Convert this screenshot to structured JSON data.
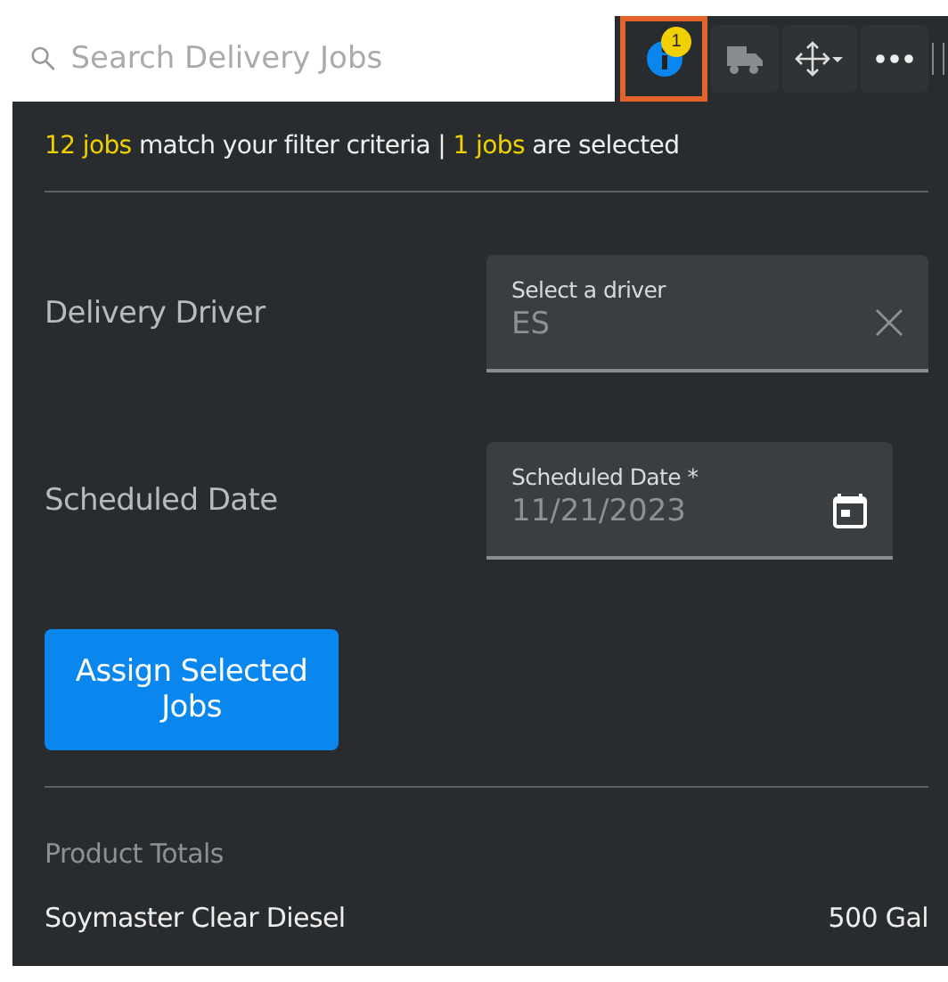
{
  "search": {
    "placeholder": "Search Delivery Jobs"
  },
  "toolbar": [
    {
      "kind": "info",
      "badge": "1",
      "selected": true
    },
    {
      "kind": "truck",
      "selected": false
    },
    {
      "kind": "move",
      "selected": false
    },
    {
      "kind": "more",
      "selected": false
    }
  ],
  "summary": {
    "match_count": "12 jobs",
    "match_text": "match your filter criteria |",
    "selected_count": "1 jobs",
    "selected_text": "are selected"
  },
  "form": [
    {
      "kind": "select",
      "label": "Delivery Driver",
      "field_label": "Select a driver",
      "value": "ES"
    },
    {
      "kind": "date",
      "label": "Scheduled Date",
      "field_label": "Scheduled Date *",
      "value": "11/21/2023"
    }
  ],
  "assign_button": "Assign Selected Jobs",
  "product_totals": {
    "title": "Product Totals",
    "rows": [
      {
        "product": "Soymaster Clear Diesel",
        "amount": "500 Gal"
      }
    ]
  }
}
